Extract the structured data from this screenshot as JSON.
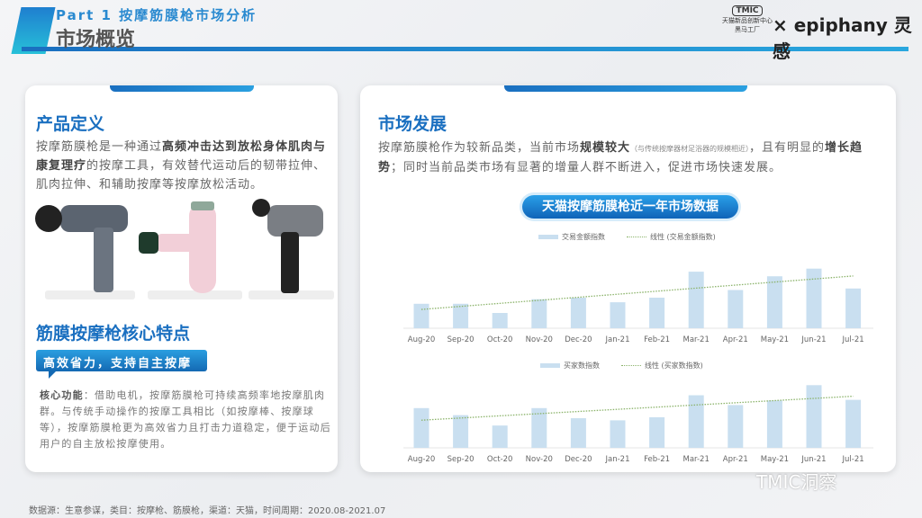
{
  "header": {
    "part": "Part 1 按摩筋膜枪市场分析",
    "title": "市场概览",
    "logo_tmic": "TMIC",
    "logo_tmic_sub": "天猫新品创新中心",
    "logo_tmic_sub2": "黑马工厂",
    "logo_partner": "× epiphany 灵感"
  },
  "left": {
    "title": "产品定义",
    "def_1": "按摩筋膜枪是一种通过",
    "def_bold": "高频冲击达到放松身体肌肉与康复理疗",
    "def_2": "的按摩工具，有效替代运动后的韧带拉伸、肌肉拉伸、和辅助按摩等按摩放松活动。",
    "title2": "筋膜按摩枪核心特点",
    "tag": "高效省力，支持自主按摩",
    "core_label": "核心功能",
    "core_text": "：借助电机，按摩筋膜枪可持续高频率地按摩肌肉群。与传统手动操作的按摩工具相比（如按摩棒、按摩球等），按摩筋膜枪更为高效省力且打击力道稳定，便于运动后用户的自主放松按摩使用。"
  },
  "right": {
    "title": "市场发展",
    "t1": "按摩筋膜枪作为较新品类，当前市场",
    "b1": "规模较大",
    "small": "（与传统按摩器材足浴器的规模相近）",
    "t2": "，且有明显的",
    "b2": "增长趋势",
    "t3": "；同时当前品类市场有显著的增量人群不断进入，促进市场快速发展。",
    "banner": "天猫按摩筋膜枪近一年市场数据"
  },
  "chart_data": [
    {
      "type": "bar",
      "categories": [
        "Aug-20",
        "Sep-20",
        "Oct-20",
        "Nov-20",
        "Dec-20",
        "Jan-21",
        "Feb-21",
        "Mar-21",
        "Apr-21",
        "May-21",
        "Jun-21",
        "Jul-21"
      ],
      "series": [
        {
          "name": "交易金额指数",
          "values": [
            80,
            80,
            50,
            95,
            100,
            85,
            100,
            185,
            125,
            170,
            195,
            130
          ]
        }
      ],
      "trendline": {
        "name": "线性 (交易金额指数)",
        "type": "linear"
      },
      "colors": {
        "bar": "#c9dff0",
        "trend": "#8bb36a"
      },
      "legend": "top",
      "grid": false
    },
    {
      "type": "bar",
      "categories": [
        "Aug-20",
        "Sep-20",
        "Oct-20",
        "Nov-20",
        "Dec-20",
        "Jan-21",
        "Feb-21",
        "Mar-21",
        "Apr-21",
        "May-21",
        "Jun-21",
        "Jul-21"
      ],
      "series": [
        {
          "name": "买家数指数",
          "values": [
            130,
            107,
            73,
            130,
            97,
            90,
            100,
            172,
            140,
            155,
            205,
            157
          ]
        }
      ],
      "trendline": {
        "name": "线性 (买家数指数)",
        "type": "linear"
      },
      "colors": {
        "bar": "#c9dff0",
        "trend": "#8bb36a"
      },
      "legend": "top",
      "grid": false
    }
  ],
  "footer": "数据源：生意参谋，类目：按摩枪、筋膜枪，渠道：天猫，时间周期：2020.08-2021.07",
  "watermark": "TMIC洞察"
}
